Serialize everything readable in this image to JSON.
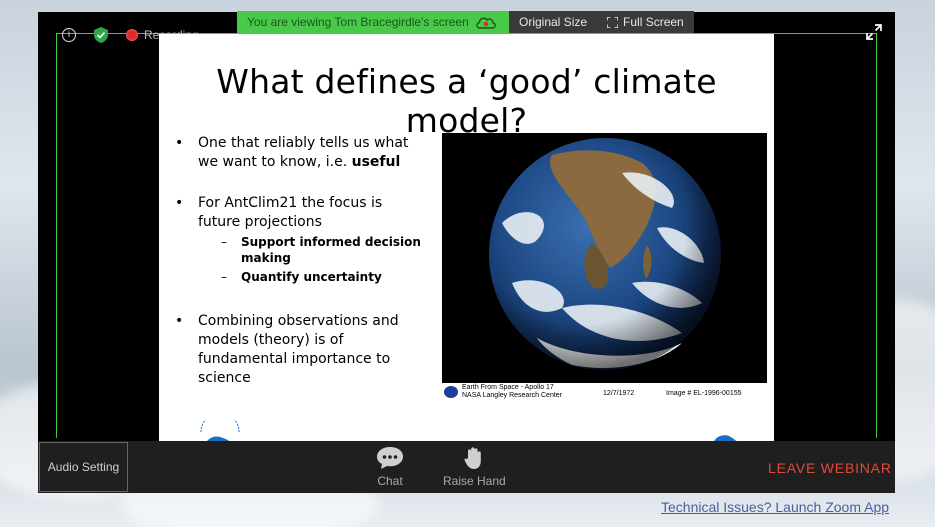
{
  "banner": {
    "viewing_text": "You are viewing Tom Bracegirdle's screen",
    "original_size_label": "Original Size",
    "full_screen_label": "Full Screen"
  },
  "status": {
    "recording_label": "Recording",
    "info_label": "i"
  },
  "slide": {
    "title": "What defines a ‘good’ climate model?",
    "bullets": [
      {
        "text": "One that reliably tells us what we want to know, i.e. ",
        "bold": "useful"
      },
      {
        "text": "For AntClim21 the focus is future projections"
      },
      {
        "text": "Combining observations and models (theory) is of fundamental importance to science"
      }
    ],
    "sub_bullets": [
      "Support informed decision making",
      "Quantify uncertainty"
    ],
    "bullet_symbol": "•",
    "dash_symbol": "–",
    "caption": {
      "line1": "Earth From Space - Apollo 17",
      "line2": "NASA Langley Research Center",
      "date": "12/7/1972",
      "image_id": "Image # EL-1996-00155"
    }
  },
  "toolbar": {
    "audio_setting_label": "Audio Setting",
    "chat_label": "Chat",
    "raise_hand_label": "Raise Hand",
    "leave_label": "LEAVE WEBINAR"
  },
  "footer": {
    "launch_link": "Technical Issues? Launch Zoom App"
  },
  "colors": {
    "banner_green": "#49c84a",
    "leave_red": "#e04a3a",
    "frame_green": "#3ccf3c"
  }
}
